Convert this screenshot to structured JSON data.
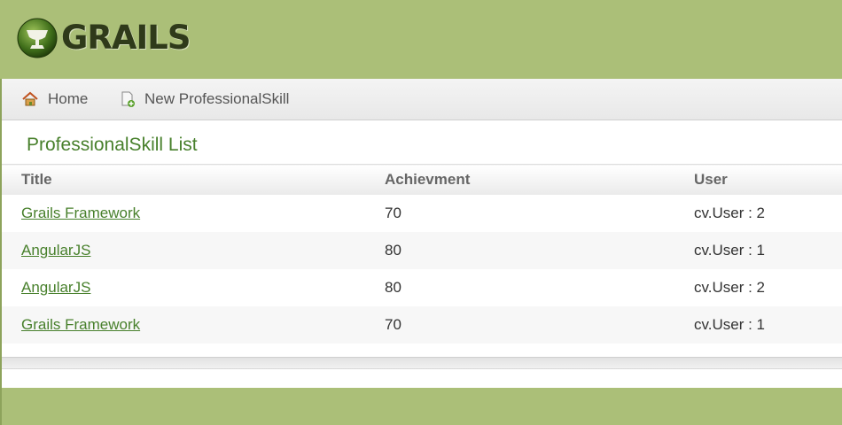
{
  "header": {
    "logo_text": "GRAILS"
  },
  "nav": {
    "home_label": "Home",
    "new_label": "New ProfessionalSkill"
  },
  "main": {
    "title": "ProfessionalSkill List",
    "columns": [
      "Title",
      "Achievment",
      "User"
    ],
    "rows": [
      {
        "title": "Grails Framework",
        "achievment": "70",
        "user": "cv.User : 2"
      },
      {
        "title": "AngularJS",
        "achievment": "80",
        "user": "cv.User : 1"
      },
      {
        "title": "AngularJS",
        "achievment": "80",
        "user": "cv.User : 2"
      },
      {
        "title": "Grails Framework",
        "achievment": "70",
        "user": "cv.User : 1"
      }
    ]
  },
  "colors": {
    "header_bg": "#abbf78",
    "link": "#48802c",
    "title": "#48802c"
  },
  "icons": {
    "home": "home-icon",
    "new": "new-document-icon"
  }
}
